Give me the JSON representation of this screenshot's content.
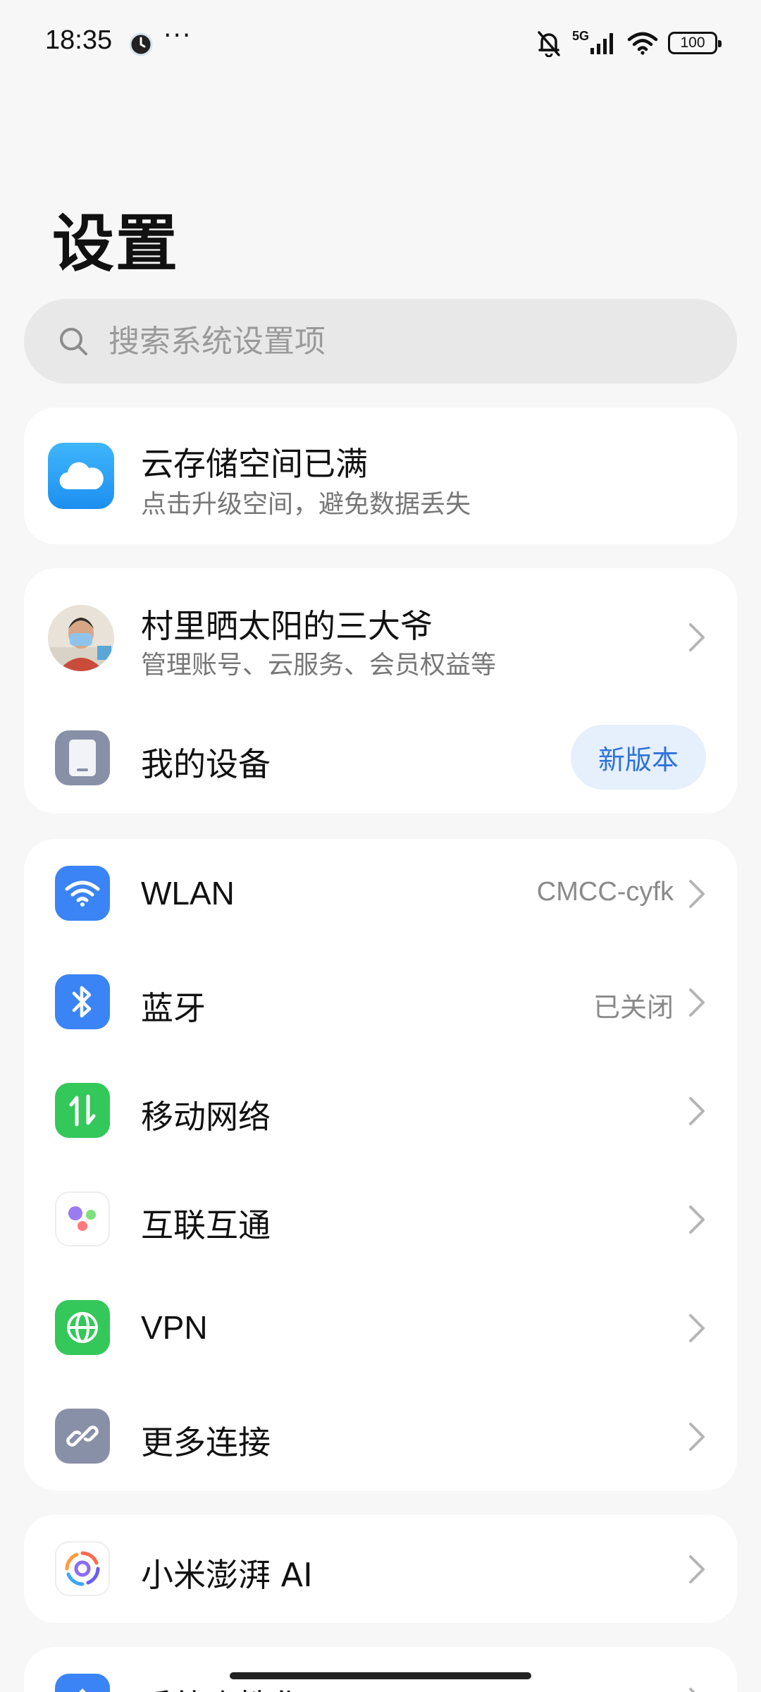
{
  "status_bar": {
    "time": "18:35",
    "more": "···",
    "network": "5G",
    "battery": "100",
    "icons": [
      "clock-icon",
      "bell-off-icon",
      "signal-icon",
      "wifi-icon",
      "battery-icon"
    ]
  },
  "page": {
    "title": "设置"
  },
  "search": {
    "placeholder": "搜索系统设置项"
  },
  "cloud_card": {
    "title": "云存储空间已满",
    "subtitle": "点击升级空间，避免数据丢失",
    "icon": "cloud-icon",
    "icon_color": "#2a9cf4"
  },
  "account_card": {
    "name": "村里晒太阳的三大爷",
    "subtitle": "管理账号、云服务、会员权益等",
    "device_label": "我的设备",
    "device_badge": "新版本"
  },
  "connectivity": {
    "items": [
      {
        "label": "WLAN",
        "value": "CMCC-cyfk",
        "icon": "wifi-icon",
        "color": "#3a84f5"
      },
      {
        "label": "蓝牙",
        "value": "已关闭",
        "icon": "bluetooth-icon",
        "color": "#3a84f5"
      },
      {
        "label": "移动网络",
        "value": "",
        "icon": "mobile-data-icon",
        "color": "#34c759"
      },
      {
        "label": "互联互通",
        "value": "",
        "icon": "interconnect-icon",
        "color": "#ffffff"
      },
      {
        "label": "VPN",
        "value": "",
        "icon": "globe-icon",
        "color": "#34c759"
      },
      {
        "label": "更多连接",
        "value": "",
        "icon": "link-icon",
        "color": "#8890a8"
      }
    ]
  },
  "ai_card": {
    "label": "小米澎湃 AI",
    "icon": "ai-swirl-icon"
  },
  "next_card": {
    "label": "系统个性化"
  }
}
